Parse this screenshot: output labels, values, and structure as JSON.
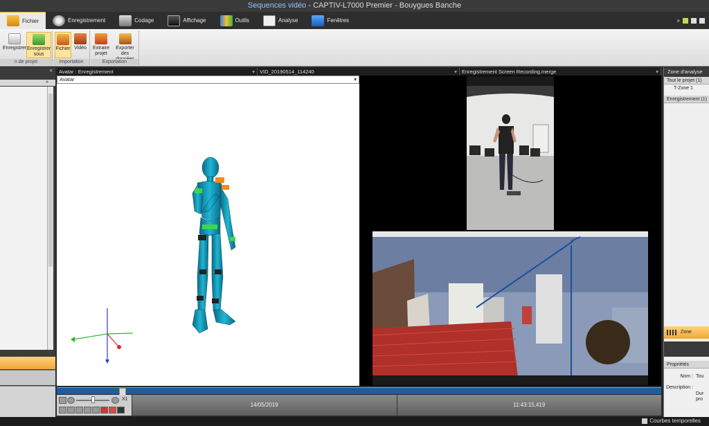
{
  "title": {
    "part1": "Sequences vidéo",
    "part2": " - CAPTIV-L7000 Premier - Bouygues Banche"
  },
  "ribbon_tabs": [
    {
      "label": "Fichier",
      "icon": "file-icon",
      "active": true
    },
    {
      "label": "Enregistrement",
      "icon": "record-icon"
    },
    {
      "label": "Codage",
      "icon": "coding-icon"
    },
    {
      "label": "Affichage",
      "icon": "display-icon"
    },
    {
      "label": "Outils",
      "icon": "tools-icon"
    },
    {
      "label": "Analyse",
      "icon": "analysis-icon"
    },
    {
      "label": "Fenêtres",
      "icon": "windows-icon"
    }
  ],
  "ribbon_right": {
    "arrows": "»"
  },
  "ribbon_groups": {
    "project": {
      "label": "n de projet",
      "buttons": [
        {
          "label": "Enregistrer"
        },
        {
          "label": "Enregistrer sous"
        }
      ]
    },
    "import": {
      "label": "Importation",
      "buttons": [
        {
          "label": "Fichier"
        },
        {
          "label": "Vidéo"
        }
      ]
    },
    "export": {
      "label": "Exportation",
      "buttons": [
        {
          "label": "Extraire projet"
        },
        {
          "label": "Exporter des données"
        }
      ]
    }
  },
  "left_panel": {
    "collapse": "«",
    "subcollapse": "»"
  },
  "panels": {
    "avatar_header": "Avatar : Enregistrement",
    "avatar_select": "Avatar",
    "video1_header": "VID_20190514_114240",
    "video2_header": "Enregistrement Screen Recording.merge"
  },
  "timeline": {
    "date": "14/05/2019",
    "time": "11:43:15,419",
    "speed": "X1"
  },
  "right_panel": {
    "title": "Zone d'analyse",
    "section1": "Tout le projet (1)",
    "item1": "T-Zone 1",
    "section2": "Enregistrement (1)",
    "zone_label": "Zone d'analyse",
    "props_title": "Propriétés",
    "nom_label": "Nom :",
    "nom_value": "Tou",
    "desc_label": "Description :",
    "desc_value1": "Dur",
    "desc_value2": "pro"
  },
  "statusbar": {
    "courbes": "Courbes temporelles"
  },
  "colors": {
    "accent": "#f0a83a",
    "avatar": "#1aa3c4",
    "sensor_green": "#3ed64a",
    "sensor_orange": "#f08a1a"
  }
}
